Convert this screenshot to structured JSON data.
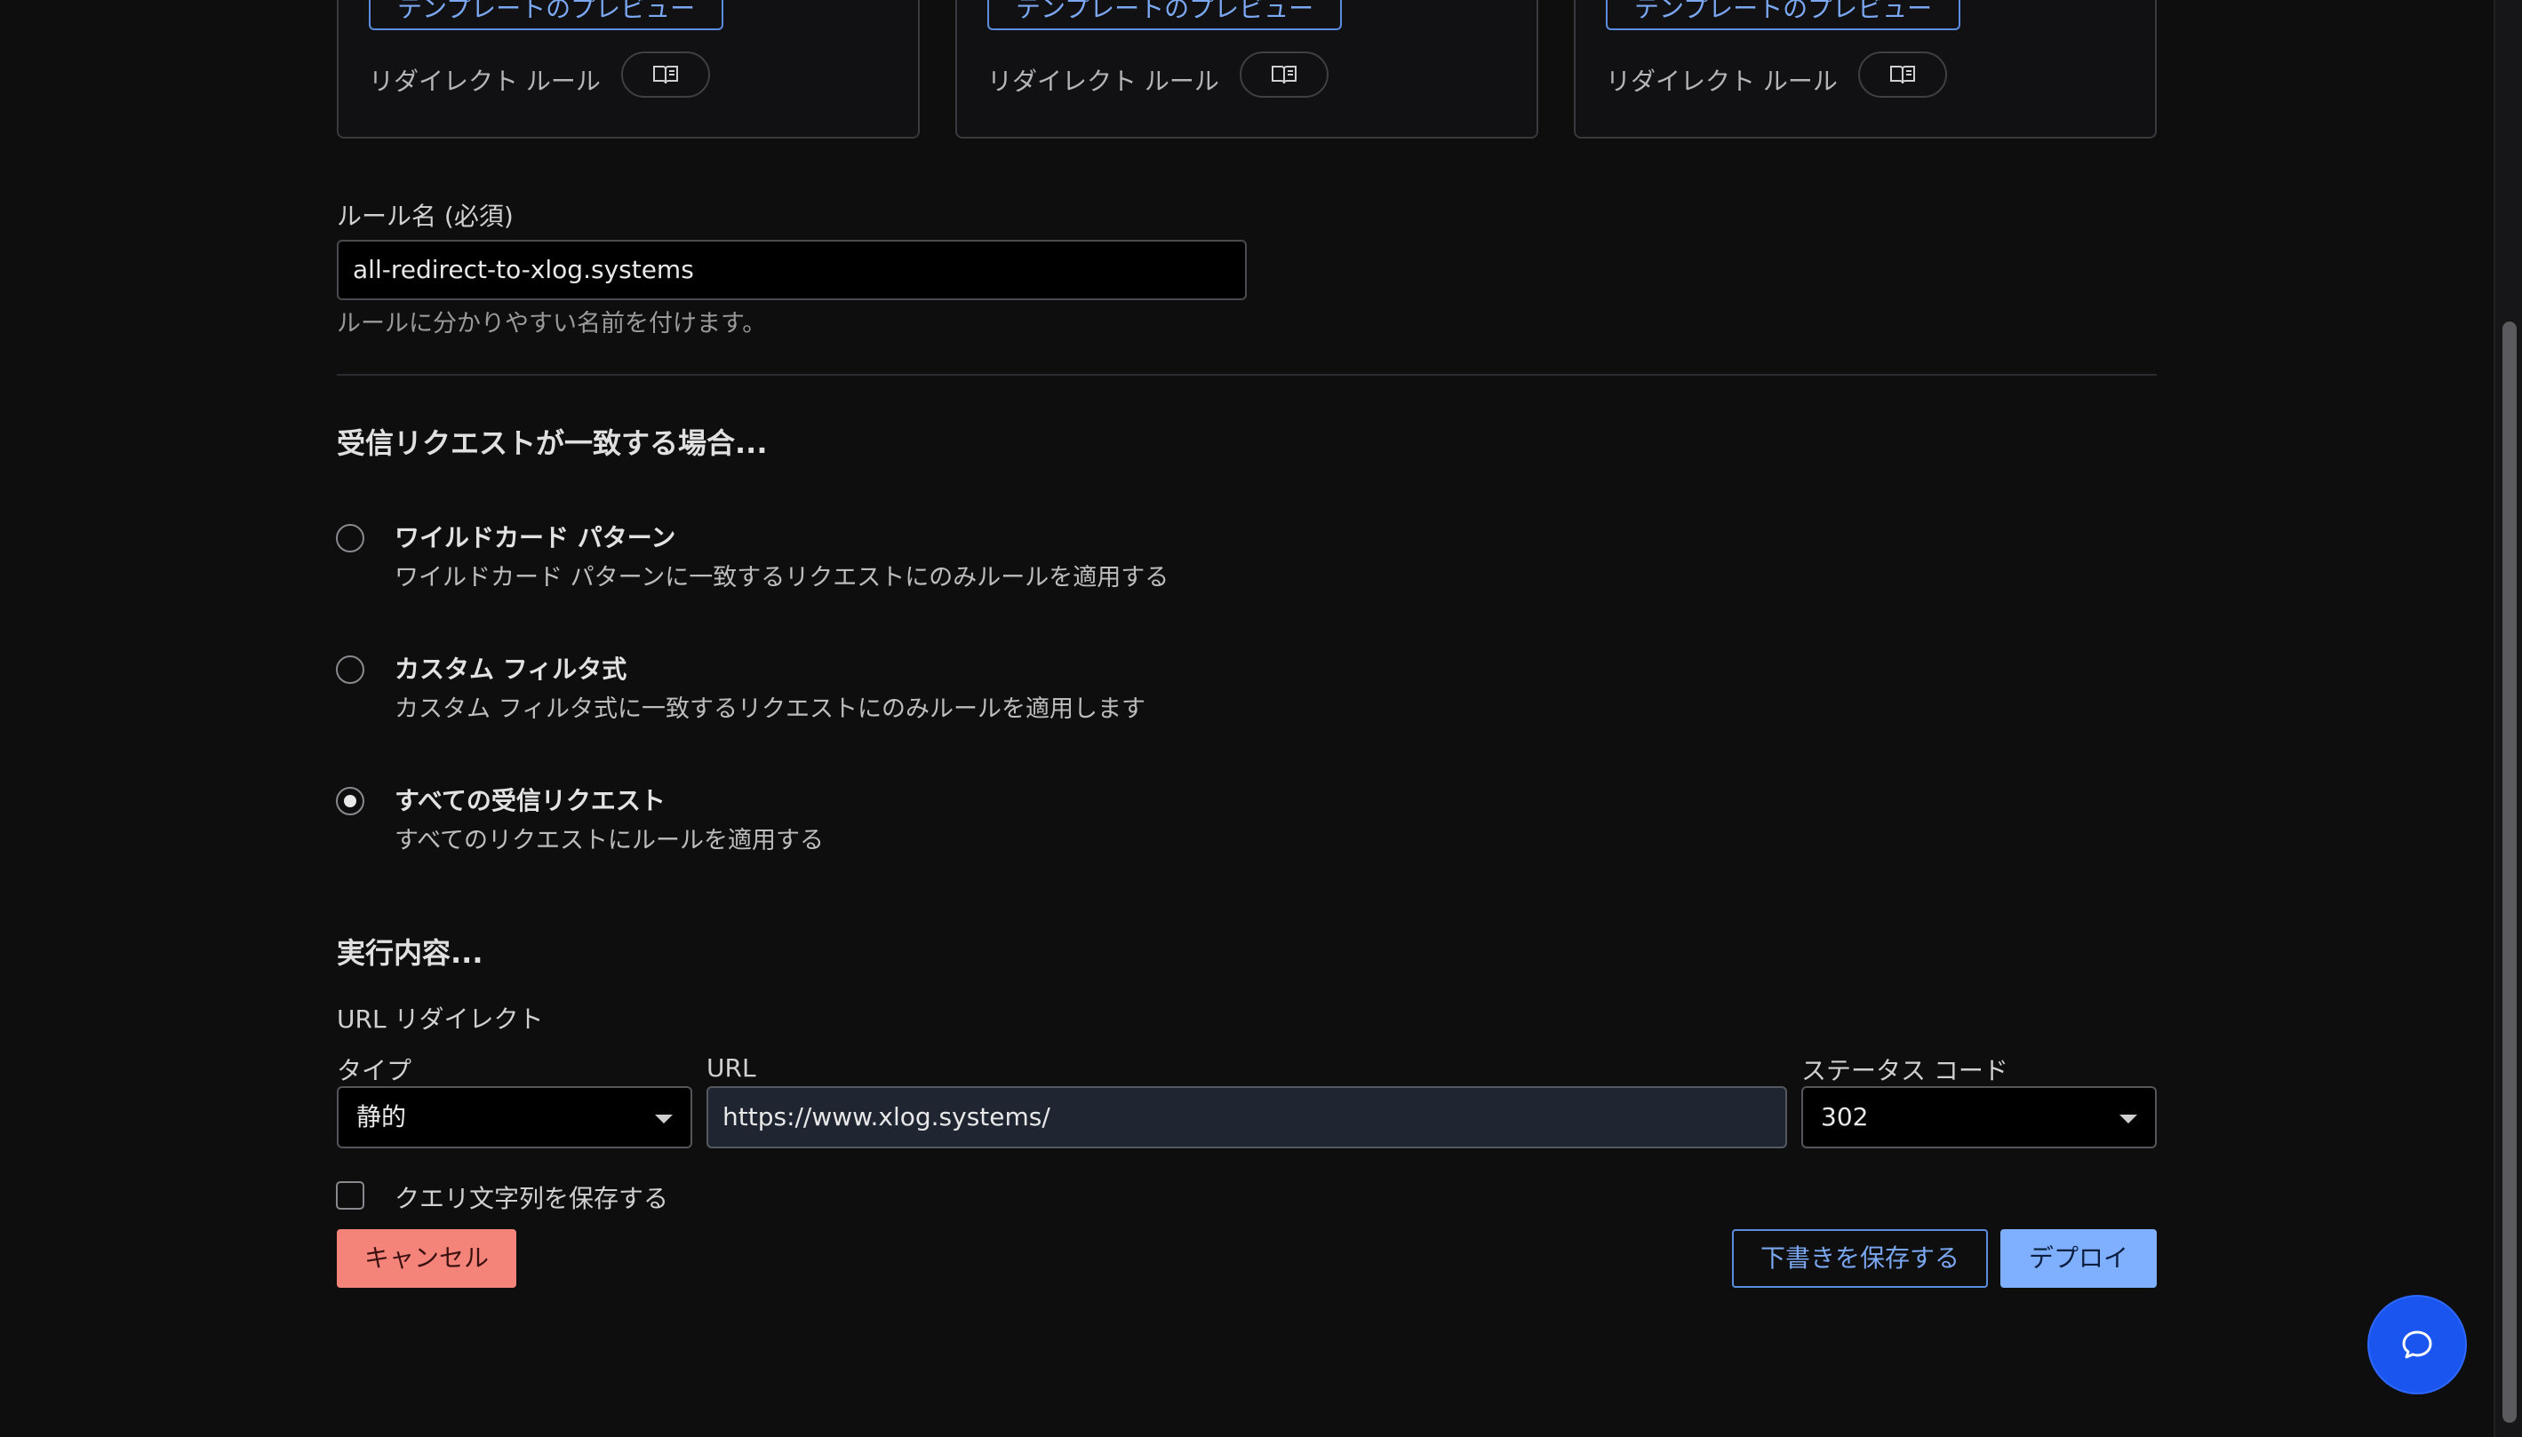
{
  "template_cards": [
    {
      "preview_label": "テンプレートのプレビュー",
      "type_label": "リダイレクト ルール"
    },
    {
      "preview_label": "テンプレートのプレビュー",
      "type_label": "リダイレクト ルール"
    },
    {
      "preview_label": "テンプレートのプレビュー",
      "type_label": "リダイレクト ルール"
    }
  ],
  "rule_name": {
    "label": "ルール名 (必須)",
    "value": "all-redirect-to-xlog.systems",
    "help": "ルールに分かりやすい名前を付けます。"
  },
  "match": {
    "heading": "受信リクエストが一致する場合...",
    "options": [
      {
        "title": "ワイルドカード パターン",
        "description": "ワイルドカード パターンに一致するリクエストにのみルールを適用する",
        "selected": false
      },
      {
        "title": "カスタム フィルタ式",
        "description": "カスタム フィルタ式に一致するリクエストにのみルールを適用します",
        "selected": false
      },
      {
        "title": "すべての受信リクエスト",
        "description": "すべてのリクエストにルールを適用する",
        "selected": true
      }
    ]
  },
  "action": {
    "heading": "実行内容...",
    "subheading": "URL リダイレクト",
    "type_label": "タイプ",
    "type_value": "静的",
    "url_label": "URL",
    "url_value": "https://www.xlog.systems/",
    "status_label": "ステータス コード",
    "status_value": "302",
    "preserve_query_label": "クエリ文字列を保存する",
    "preserve_query_checked": false
  },
  "buttons": {
    "cancel": "キャンセル",
    "save_draft": "下書きを保存する",
    "deploy": "デプロイ"
  },
  "icons": {
    "book": "book-icon",
    "chat": "chat-bubble-icon"
  },
  "colors": {
    "accent": "#7fb0ff",
    "danger": "#f4837a",
    "fab": "#1a55f0"
  }
}
